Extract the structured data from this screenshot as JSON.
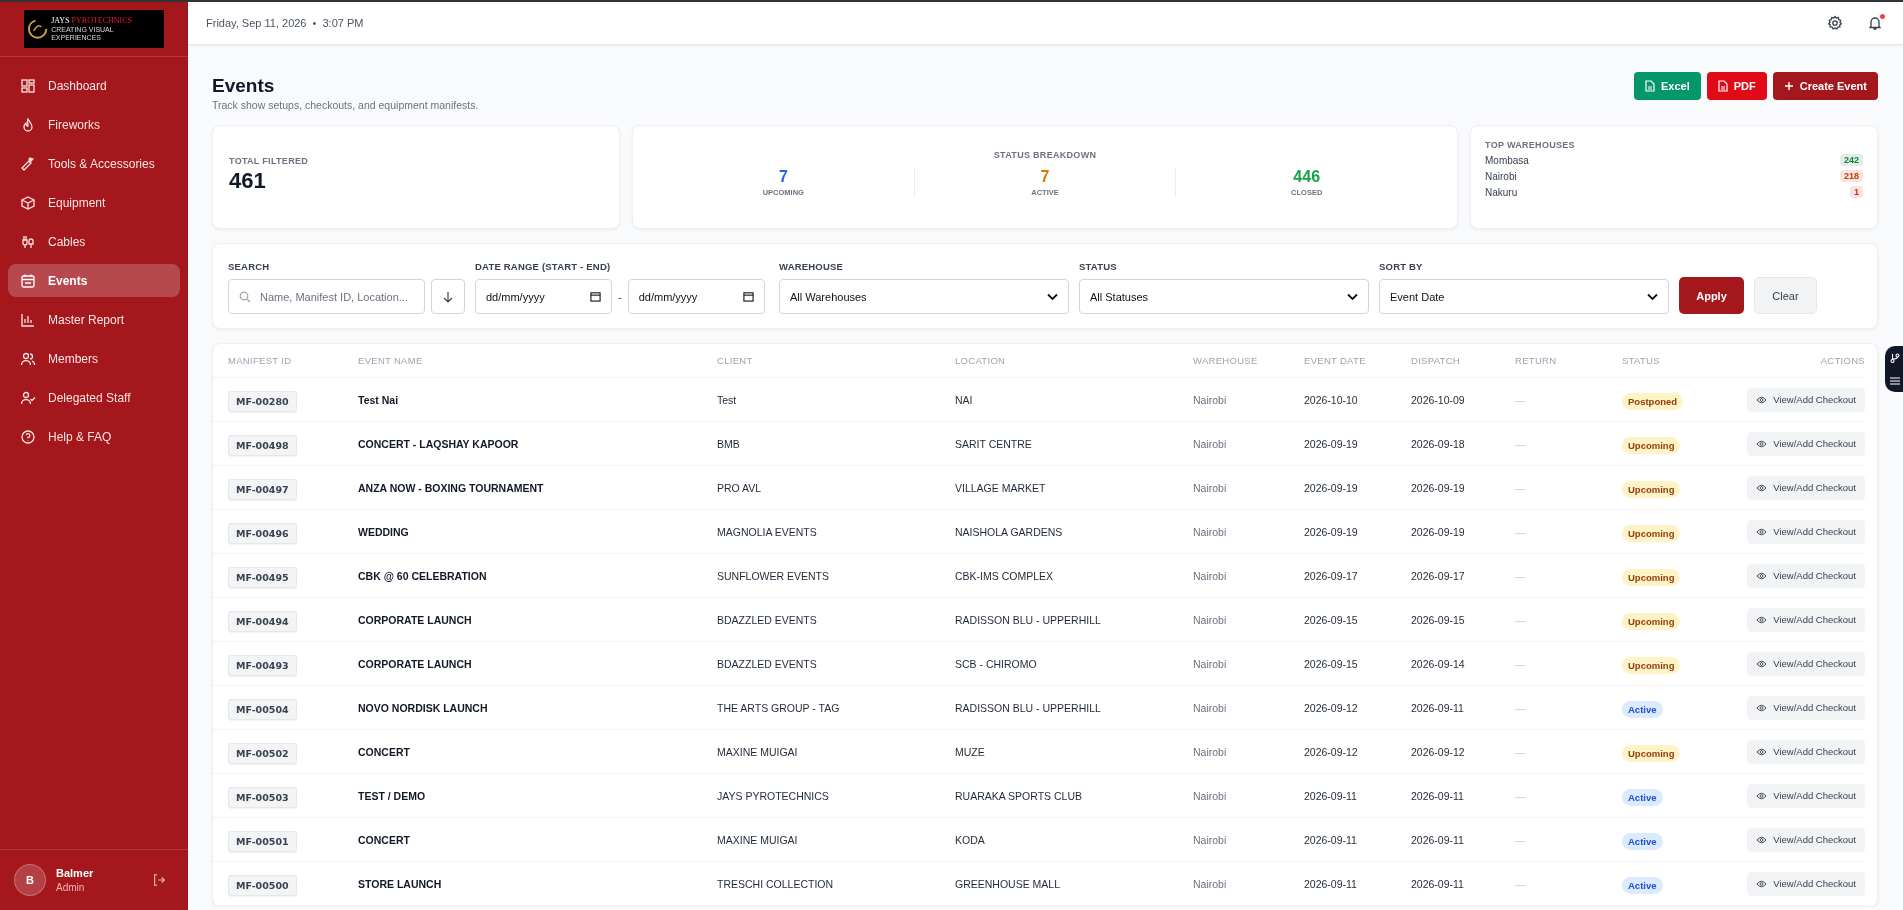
{
  "logo": {
    "name_a": "JAYS",
    "name_b": "PYROTECHNICS",
    "tagline": "CREATING VISUAL EXPERIENCES"
  },
  "sidebar": {
    "items": [
      {
        "label": "Dashboard",
        "selected": false
      },
      {
        "label": "Fireworks",
        "selected": false
      },
      {
        "label": "Tools & Accessories",
        "selected": false
      },
      {
        "label": "Equipment",
        "selected": false
      },
      {
        "label": "Cables",
        "selected": false
      },
      {
        "label": "Events",
        "selected": true
      },
      {
        "label": "Master Report",
        "selected": false
      },
      {
        "label": "Members",
        "selected": false
      },
      {
        "label": "Delegated Staff",
        "selected": false
      },
      {
        "label": "Help & FAQ",
        "selected": false
      }
    ],
    "user": {
      "initial": "B",
      "name": "Balmer",
      "role": "Admin"
    }
  },
  "header": {
    "date": "Friday, Sep 11, 2026",
    "separator": "•",
    "time": "3:07 PM",
    "notification_unread": true
  },
  "page": {
    "title": "Events",
    "subtitle": "Track show setups, checkouts, and equipment manifests.",
    "buttons": [
      {
        "label": "Excel",
        "kind": "excel"
      },
      {
        "label": "PDF",
        "kind": "pdf"
      },
      {
        "label": "Create Event",
        "kind": "create"
      }
    ]
  },
  "stats": {
    "total": {
      "label": "TOTAL FILTERED",
      "value": "461"
    },
    "breakdown": {
      "title": "STATUS BREAKDOWN",
      "items": [
        {
          "value": "7",
          "label": "UPCOMING",
          "color": "#2563eb"
        },
        {
          "value": "7",
          "label": "ACTIVE",
          "color": "#d97706"
        },
        {
          "value": "446",
          "label": "CLOSED",
          "color": "#16a34a"
        }
      ]
    },
    "warehouses": {
      "title": "TOP WAREHOUSES",
      "items": [
        {
          "name": "Mombasa",
          "count": "242",
          "color": "#15803d"
        },
        {
          "name": "Nairobi",
          "count": "218",
          "color": "#c2410c"
        },
        {
          "name": "Nakuru",
          "count": "1",
          "color": "#dc2626"
        }
      ]
    }
  },
  "filters": {
    "search": {
      "label": "SEARCH",
      "placeholder": "Name, Manifest ID, Location..."
    },
    "date_range": {
      "label": "DATE RANGE (START - END)",
      "start_placeholder": "dd/mm/yyyy",
      "separator": "-",
      "end_placeholder": "dd/mm/yyyy"
    },
    "warehouse": {
      "label": "WAREHOUSE",
      "value": "All Warehouses"
    },
    "status": {
      "label": "STATUS",
      "value": "All Statuses"
    },
    "sort_by": {
      "label": "SORT BY",
      "value": "Event Date"
    },
    "apply": "Apply",
    "clear": "Clear"
  },
  "table": {
    "columns": [
      "MANIFEST ID",
      "EVENT NAME",
      "CLIENT",
      "LOCATION",
      "WAREHOUSE",
      "EVENT DATE",
      "DISPATCH",
      "RETURN",
      "STATUS",
      "ACTIONS"
    ],
    "rows": [
      {
        "id": "MF-00280",
        "event": "Test Nai",
        "client": "Test",
        "location": "NAI",
        "warehouse": "Nairobi",
        "event_date": "2026-10-10",
        "dispatch": "2026-10-09",
        "return": "—",
        "status": "Postponed",
        "kind": "postponed",
        "action": "View/Add Checkout"
      },
      {
        "id": "MF-00498",
        "event": "CONCERT - LAQSHAY KAPOOR",
        "client": "BMB",
        "location": "SARIT CENTRE",
        "warehouse": "Nairobi",
        "event_date": "2026-09-19",
        "dispatch": "2026-09-18",
        "return": "—",
        "status": "Upcoming",
        "kind": "upcoming",
        "action": "View/Add Checkout"
      },
      {
        "id": "MF-00497",
        "event": "ANZA NOW - BOXING TOURNAMENT",
        "client": "PRO AVL",
        "location": "VILLAGE MARKET",
        "warehouse": "Nairobi",
        "event_date": "2026-09-19",
        "dispatch": "2026-09-19",
        "return": "—",
        "status": "Upcoming",
        "kind": "upcoming",
        "action": "View/Add Checkout"
      },
      {
        "id": "MF-00496",
        "event": "WEDDING",
        "client": "MAGNOLIA EVENTS",
        "location": "NAISHOLA GARDENS",
        "warehouse": "Nairobi",
        "event_date": "2026-09-19",
        "dispatch": "2026-09-19",
        "return": "—",
        "status": "Upcoming",
        "kind": "upcoming",
        "action": "View/Add Checkout"
      },
      {
        "id": "MF-00495",
        "event": "CBK @ 60 CELEBRATION",
        "client": "SUNFLOWER EVENTS",
        "location": "CBK-IMS COMPLEX",
        "warehouse": "Nairobi",
        "event_date": "2026-09-17",
        "dispatch": "2026-09-17",
        "return": "—",
        "status": "Upcoming",
        "kind": "upcoming",
        "action": "View/Add Checkout"
      },
      {
        "id": "MF-00494",
        "event": "CORPORATE LAUNCH",
        "client": "BDAZZLED EVENTS",
        "location": "RADISSON BLU - UPPERHILL",
        "warehouse": "Nairobi",
        "event_date": "2026-09-15",
        "dispatch": "2026-09-15",
        "return": "—",
        "status": "Upcoming",
        "kind": "upcoming",
        "action": "View/Add Checkout"
      },
      {
        "id": "MF-00493",
        "event": "CORPORATE LAUNCH",
        "client": "BDAZZLED EVENTS",
        "location": "SCB - CHIROMO",
        "warehouse": "Nairobi",
        "event_date": "2026-09-15",
        "dispatch": "2026-09-14",
        "return": "—",
        "status": "Upcoming",
        "kind": "upcoming",
        "action": "View/Add Checkout"
      },
      {
        "id": "MF-00504",
        "event": "NOVO NORDISK LAUNCH",
        "client": "THE ARTS GROUP - TAG",
        "location": "RADISSON BLU - UPPERHILL",
        "warehouse": "Nairobi",
        "event_date": "2026-09-12",
        "dispatch": "2026-09-11",
        "return": "—",
        "status": "Active",
        "kind": "active",
        "action": "View/Add Checkout"
      },
      {
        "id": "MF-00502",
        "event": "CONCERT",
        "client": "MAXINE MUIGAI",
        "location": "MUZE",
        "warehouse": "Nairobi",
        "event_date": "2026-09-12",
        "dispatch": "2026-09-12",
        "return": "—",
        "status": "Upcoming",
        "kind": "upcoming",
        "action": "View/Add Checkout"
      },
      {
        "id": "MF-00503",
        "event": "TEST / DEMO",
        "client": "JAYS PYROTECHNICS",
        "location": "RUARAKA SPORTS CLUB",
        "warehouse": "Nairobi",
        "event_date": "2026-09-11",
        "dispatch": "2026-09-11",
        "return": "—",
        "status": "Active",
        "kind": "active",
        "action": "View/Add Checkout"
      },
      {
        "id": "MF-00501",
        "event": "CONCERT",
        "client": "MAXINE MUIGAI",
        "location": "KODA",
        "warehouse": "Nairobi",
        "event_date": "2026-09-11",
        "dispatch": "2026-09-11",
        "return": "—",
        "status": "Active",
        "kind": "active",
        "action": "View/Add Checkout"
      },
      {
        "id": "MF-00500",
        "event": "STORE LAUNCH",
        "client": "TRESCHI COLLECTION",
        "location": "GREENHOUSE MALL",
        "warehouse": "Nairobi",
        "event_date": "2026-09-11",
        "dispatch": "2026-09-11",
        "return": "—",
        "status": "Active",
        "kind": "active",
        "action": "View/Add Checkout"
      }
    ]
  }
}
